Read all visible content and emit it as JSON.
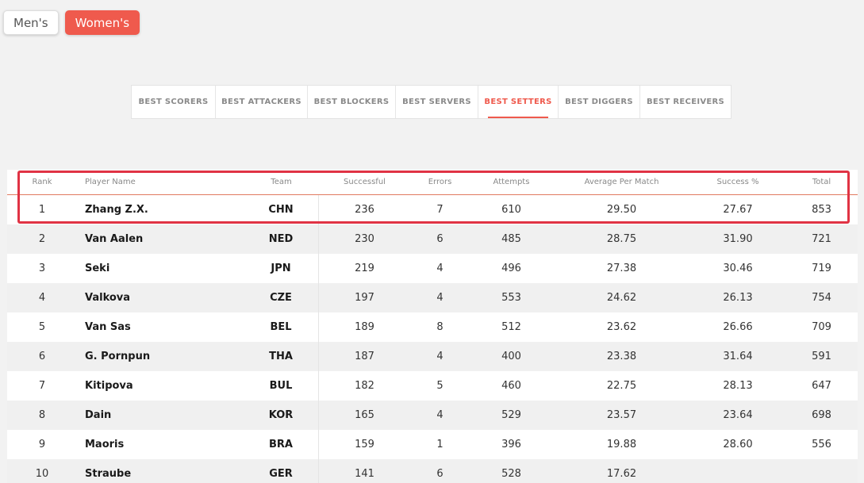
{
  "gender_toggle": {
    "mens": "Men's",
    "womens": "Women's",
    "selected": "Women's"
  },
  "tabs": [
    {
      "label": "BEST SCORERS",
      "active": false
    },
    {
      "label": "BEST ATTACKERS",
      "active": false
    },
    {
      "label": "BEST BLOCKERS",
      "active": false
    },
    {
      "label": "BEST SERVERS",
      "active": false
    },
    {
      "label": "BEST SETTERS",
      "active": true
    },
    {
      "label": "BEST DIGGERS",
      "active": false
    },
    {
      "label": "BEST RECEIVERS",
      "active": false
    }
  ],
  "table": {
    "headers": [
      "Rank",
      "Player Name",
      "Team",
      "Successful",
      "Errors",
      "Attempts",
      "Average Per Match",
      "Success %",
      "Total"
    ],
    "rows": [
      [
        "1",
        "Zhang Z.X.",
        "CHN",
        "236",
        "7",
        "610",
        "29.50",
        "27.67",
        "853"
      ],
      [
        "2",
        "Van Aalen",
        "NED",
        "230",
        "6",
        "485",
        "28.75",
        "31.90",
        "721"
      ],
      [
        "3",
        "Seki",
        "JPN",
        "219",
        "4",
        "496",
        "27.38",
        "30.46",
        "719"
      ],
      [
        "4",
        "Valkova",
        "CZE",
        "197",
        "4",
        "553",
        "24.62",
        "26.13",
        "754"
      ],
      [
        "5",
        "Van Sas",
        "BEL",
        "189",
        "8",
        "512",
        "23.62",
        "26.66",
        "709"
      ],
      [
        "6",
        "G. Pornpun",
        "THA",
        "187",
        "4",
        "400",
        "23.38",
        "31.64",
        "591"
      ],
      [
        "7",
        "Kitipova",
        "BUL",
        "182",
        "5",
        "460",
        "22.75",
        "28.13",
        "647"
      ],
      [
        "8",
        "Dain",
        "KOR",
        "165",
        "4",
        "529",
        "23.57",
        "23.64",
        "698"
      ],
      [
        "9",
        "Maoris",
        "BRA",
        "159",
        "1",
        "396",
        "19.88",
        "28.60",
        "556"
      ],
      [
        "10",
        "Straube",
        "GER",
        "141",
        "6",
        "528",
        "17.62",
        "",
        ""
      ]
    ]
  },
  "colors": {
    "accent": "#ef5a4d",
    "highlight": "#e03344"
  }
}
